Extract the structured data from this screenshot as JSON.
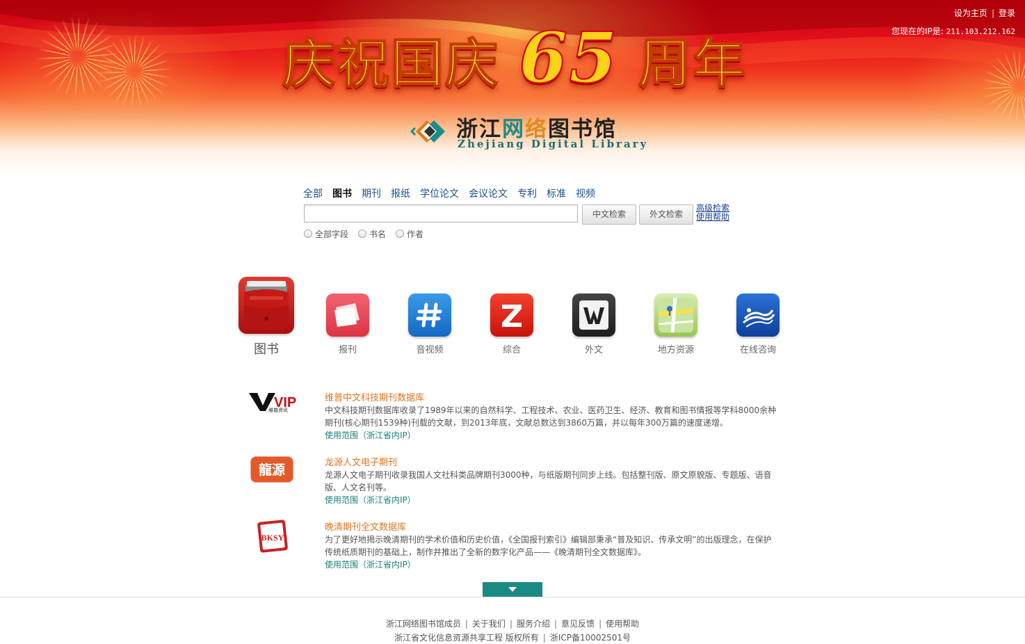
{
  "header": {
    "set_home": "设为主页",
    "login": "登录",
    "ip_label": "您现在的IP是:",
    "ip": "211.103.212.162",
    "banner_prefix": "庆祝国庆",
    "banner_number": "65",
    "banner_suffix": "周年"
  },
  "logo": {
    "cn_part1": "浙江",
    "cn_part2": "网",
    "cn_part3": "络",
    "cn_part4": "图书馆",
    "en": "Zhejiang Digital Library"
  },
  "search": {
    "tabs": [
      "全部",
      "图书",
      "期刊",
      "报纸",
      "学位论文",
      "会议论文",
      "专利",
      "标准",
      "视频"
    ],
    "active_tab": "图书",
    "input_value": "",
    "cn_button": "中文检索",
    "foreign_button": "外文检索",
    "advanced": "高级检索",
    "help": "使用帮助",
    "radios": [
      "全部字段",
      "书名",
      "作者"
    ]
  },
  "categories": [
    {
      "label": "图书",
      "icon": "book-bag-icon",
      "color": "#c8201e"
    },
    {
      "label": "报刊",
      "icon": "newspaper-icon",
      "color": "#ea4a58"
    },
    {
      "label": "音视频",
      "icon": "hash-icon",
      "color": "#1a7ed6"
    },
    {
      "label": "综合",
      "icon": "z-logo-icon",
      "color": "#e02a1a"
    },
    {
      "label": "外文",
      "icon": "w-logo-icon",
      "color": "#2e2e2e"
    },
    {
      "label": "地方资源",
      "icon": "map-icon",
      "color": "#9ac552"
    },
    {
      "label": "在线咨询",
      "icon": "wave-logo-icon",
      "color": "#1552b8"
    }
  ],
  "resources": [
    {
      "title": "维普中文科技期刊数据库",
      "desc": "中文科技期刊数据库收录了1989年以来的自然科学、工程技术、农业、医药卫生、经济、教育和图书情报等学科8000余种期刊(核心期刊1539种)刊载的文献，到2013年底，文献总数达到3860万篇，并以每年300万篇的速度递增。",
      "scope": "使用范围（浙江省内IP）",
      "logo_text": "VIP",
      "logo_sub": "维普资讯"
    },
    {
      "title": "龙源人文电子期刊",
      "desc": "龙源人文电子期刊收录我国人文社科类品牌期刊3000种，与纸版期刊同步上线。包括整刊版、原文原貌版、专题版、语音版、人文名刊等。",
      "scope": "使用范围（浙江省内IP）",
      "logo_text": "龍源"
    },
    {
      "title": "晚清期刊全文数据库",
      "desc": "为了更好地揭示晚清期刊的学术价值和历史价值，《全国报刊索引》编辑部秉承“普及知识、传承文明”的出版理念，在保护传统纸质期刊的基础上，制作并推出了全新的数字化产品——《晚清期刊全文数据库》。",
      "scope": "使用范围（浙江省内IP）",
      "logo_text": "BKSY"
    }
  ],
  "footer": {
    "links": [
      "浙江网络图书馆成员",
      "关于我们",
      "服务介绍",
      "意见反馈",
      "使用帮助"
    ],
    "copyright": "浙江省文化信息资源共享工程  版权所有",
    "icp": "浙ICP备10002501号"
  }
}
